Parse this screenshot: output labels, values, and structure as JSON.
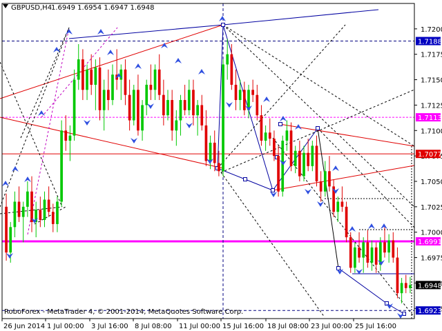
{
  "header": {
    "symbol": "GBPUSD,H4",
    "ohlc": "1.6949 1.6954 1.6947 1.6948"
  },
  "footer": {
    "copyright": "RoboForex - MetaTrader 4, © 2001-2014, MetaQuotes Software Corp."
  },
  "colors": {
    "bull": "#00c800",
    "bear": "#e00000",
    "grid": "#000000",
    "trend_blue": "#0000c0",
    "trend_red": "#e00000",
    "magenta": "#ff00ff",
    "tag_blue": "#0000c0",
    "tag_magenta": "#ff00ff",
    "tag_red": "#e00000"
  },
  "chart_data": {
    "type": "candlestick",
    "symbol": "GBPUSD",
    "timeframe": "H4",
    "ylim": [
      1.6915,
      1.7225
    ],
    "y_ticks": [
      "1.7200",
      "1.7175",
      "1.7150",
      "1.7125",
      "1.7100",
      "1.7075",
      "1.7050",
      "1.7025",
      "1.7000",
      "1.6975",
      "1.6950",
      "1.6925"
    ],
    "x_ticks": [
      "26 Jun 2014",
      "1 Jul 00:00",
      "3 Jul 16:00",
      "8 Jul 08:00",
      "11 Jul 00:00",
      "15 Jul 16:00",
      "18 Jul 08:00",
      "23 Jul 00:00",
      "25 Jul 16:00"
    ],
    "price_levels": [
      {
        "label": "1.7188",
        "value": 1.7188,
        "style": "blue-dash",
        "tag": "blue"
      },
      {
        "label": "1.7113",
        "value": 1.7113,
        "style": "magenta-dash",
        "tag": "magenta"
      },
      {
        "label": "1.7077",
        "value": 1.7077,
        "style": "red-solid",
        "tag": "red"
      },
      {
        "label": "1.6991",
        "value": 1.6991,
        "style": "magenta-thick",
        "tag": "magenta"
      },
      {
        "label": "1.6948",
        "value": 1.6948,
        "style": "none",
        "tag": "black"
      },
      {
        "label": "1.6923",
        "value": 1.6923,
        "style": "blue-dash",
        "tag": "blue"
      }
    ],
    "candles": [
      [
        1.7025,
        1.7038,
        1.6972,
        1.698
      ],
      [
        1.698,
        1.701,
        1.697,
        1.7005
      ],
      [
        1.7005,
        1.704,
        1.6995,
        1.703
      ],
      [
        1.703,
        1.7045,
        1.701,
        1.7015
      ],
      [
        1.7015,
        1.703,
        1.699,
        1.7025
      ],
      [
        1.7025,
        1.705,
        1.7015,
        1.704
      ],
      [
        1.704,
        1.7055,
        1.7,
        1.701
      ],
      [
        1.701,
        1.703,
        1.6995,
        1.7022
      ],
      [
        1.7022,
        1.7035,
        1.7005,
        1.7012
      ],
      [
        1.7012,
        1.704,
        1.7005,
        1.7032
      ],
      [
        1.7032,
        1.7045,
        1.7015,
        1.702
      ],
      [
        1.702,
        1.7028,
        1.7,
        1.7008
      ],
      [
        1.7008,
        1.7035,
        1.7,
        1.703
      ],
      [
        1.703,
        1.711,
        1.7025,
        1.71
      ],
      [
        1.71,
        1.7115,
        1.708,
        1.709
      ],
      [
        1.709,
        1.7105,
        1.707,
        1.7095
      ],
      [
        1.7095,
        1.716,
        1.709,
        1.715
      ],
      [
        1.715,
        1.7185,
        1.714,
        1.717
      ],
      [
        1.717,
        1.718,
        1.713,
        1.714
      ],
      [
        1.714,
        1.7165,
        1.713,
        1.716
      ],
      [
        1.716,
        1.7175,
        1.7135,
        1.7145
      ],
      [
        1.7145,
        1.717,
        1.712,
        1.7162
      ],
      [
        1.7162,
        1.7172,
        1.711,
        1.712
      ],
      [
        1.712,
        1.715,
        1.71,
        1.714
      ],
      [
        1.714,
        1.716,
        1.712,
        1.713
      ],
      [
        1.713,
        1.7165,
        1.7125,
        1.7155
      ],
      [
        1.7155,
        1.718,
        1.714,
        1.715
      ],
      [
        1.715,
        1.7165,
        1.713,
        1.716
      ],
      [
        1.716,
        1.717,
        1.7125,
        1.7135
      ],
      [
        1.7135,
        1.715,
        1.71,
        1.711
      ],
      [
        1.711,
        1.7145,
        1.7105,
        1.714
      ],
      [
        1.714,
        1.7155,
        1.7095,
        1.71
      ],
      [
        1.71,
        1.713,
        1.709,
        1.7125
      ],
      [
        1.7125,
        1.715,
        1.7115,
        1.7145
      ],
      [
        1.7145,
        1.7165,
        1.713,
        1.714
      ],
      [
        1.714,
        1.7165,
        1.713,
        1.716
      ],
      [
        1.716,
        1.7175,
        1.713,
        1.7135
      ],
      [
        1.7135,
        1.715,
        1.7105,
        1.7115
      ],
      [
        1.7115,
        1.714,
        1.711,
        1.713
      ],
      [
        1.713,
        1.714,
        1.709,
        1.71
      ],
      [
        1.71,
        1.712,
        1.7085,
        1.711
      ],
      [
        1.711,
        1.7135,
        1.7095,
        1.713
      ],
      [
        1.713,
        1.7145,
        1.7115,
        1.712
      ],
      [
        1.712,
        1.715,
        1.7115,
        1.714
      ],
      [
        1.714,
        1.715,
        1.7105,
        1.7115
      ],
      [
        1.7115,
        1.713,
        1.7095,
        1.7125
      ],
      [
        1.7125,
        1.7135,
        1.71,
        1.7105
      ],
      [
        1.7105,
        1.712,
        1.7065,
        1.707
      ],
      [
        1.707,
        1.7095,
        1.7062,
        1.7088
      ],
      [
        1.7088,
        1.71,
        1.706,
        1.7068
      ],
      [
        1.7068,
        1.708,
        1.7055,
        1.706
      ],
      [
        1.706,
        1.717,
        1.7055,
        1.7165
      ],
      [
        1.7165,
        1.719,
        1.715,
        1.7175
      ],
      [
        1.7175,
        1.7185,
        1.714,
        1.7145
      ],
      [
        1.7145,
        1.716,
        1.712,
        1.713
      ],
      [
        1.713,
        1.715,
        1.712,
        1.714
      ],
      [
        1.714,
        1.7148,
        1.7115,
        1.712
      ],
      [
        1.712,
        1.7145,
        1.7112,
        1.714
      ],
      [
        1.714,
        1.715,
        1.7128,
        1.7135
      ],
      [
        1.7135,
        1.7145,
        1.711,
        1.7115
      ],
      [
        1.7115,
        1.7125,
        1.7085,
        1.709
      ],
      [
        1.709,
        1.7105,
        1.708,
        1.7098
      ],
      [
        1.7098,
        1.7112,
        1.7085,
        1.7092
      ],
      [
        1.7092,
        1.71,
        1.707,
        1.7075
      ],
      [
        1.7075,
        1.7085,
        1.7035,
        1.704
      ],
      [
        1.704,
        1.7095,
        1.7035,
        1.709
      ],
      [
        1.709,
        1.711,
        1.708,
        1.71
      ],
      [
        1.71,
        1.7108,
        1.706,
        1.7065
      ],
      [
        1.7065,
        1.7085,
        1.7058,
        1.708
      ],
      [
        1.708,
        1.709,
        1.705,
        1.7055
      ],
      [
        1.7055,
        1.7085,
        1.705,
        1.7078
      ],
      [
        1.7078,
        1.7092,
        1.706,
        1.7065
      ],
      [
        1.7065,
        1.709,
        1.706,
        1.7085
      ],
      [
        1.7085,
        1.7095,
        1.7045,
        1.705
      ],
      [
        1.705,
        1.706,
        1.703,
        1.704
      ],
      [
        1.704,
        1.707,
        1.7035,
        1.706
      ],
      [
        1.706,
        1.7075,
        1.704,
        1.7045
      ],
      [
        1.7045,
        1.7052,
        1.7015,
        1.702
      ],
      [
        1.702,
        1.7035,
        1.701,
        1.703
      ],
      [
        1.703,
        1.7045,
        1.702,
        1.7025
      ],
      [
        1.7025,
        1.703,
        1.699,
        1.6995
      ],
      [
        1.6995,
        1.7,
        1.696,
        1.6965
      ],
      [
        1.6965,
        1.699,
        1.696,
        1.6985
      ],
      [
        1.6985,
        1.7,
        1.697,
        1.6975
      ],
      [
        1.6975,
        1.6995,
        1.696,
        1.699
      ],
      [
        1.699,
        1.7002,
        1.6965,
        1.697
      ],
      [
        1.697,
        1.6992,
        1.6962,
        1.6985
      ],
      [
        1.6985,
        1.699,
        1.696,
        1.6968
      ],
      [
        1.6968,
        1.6995,
        1.6962,
        1.699
      ],
      [
        1.699,
        1.7005,
        1.6975,
        1.698
      ],
      [
        1.698,
        1.6998,
        1.697,
        1.6992
      ],
      [
        1.6992,
        1.7,
        1.697,
        1.6975
      ],
      [
        1.6975,
        1.6985,
        1.6935,
        1.694
      ],
      [
        1.694,
        1.6955,
        1.693,
        1.695
      ],
      [
        1.695,
        1.6958,
        1.694,
        1.6945
      ],
      [
        1.6945,
        1.6956,
        1.694,
        1.6948
      ]
    ]
  }
}
